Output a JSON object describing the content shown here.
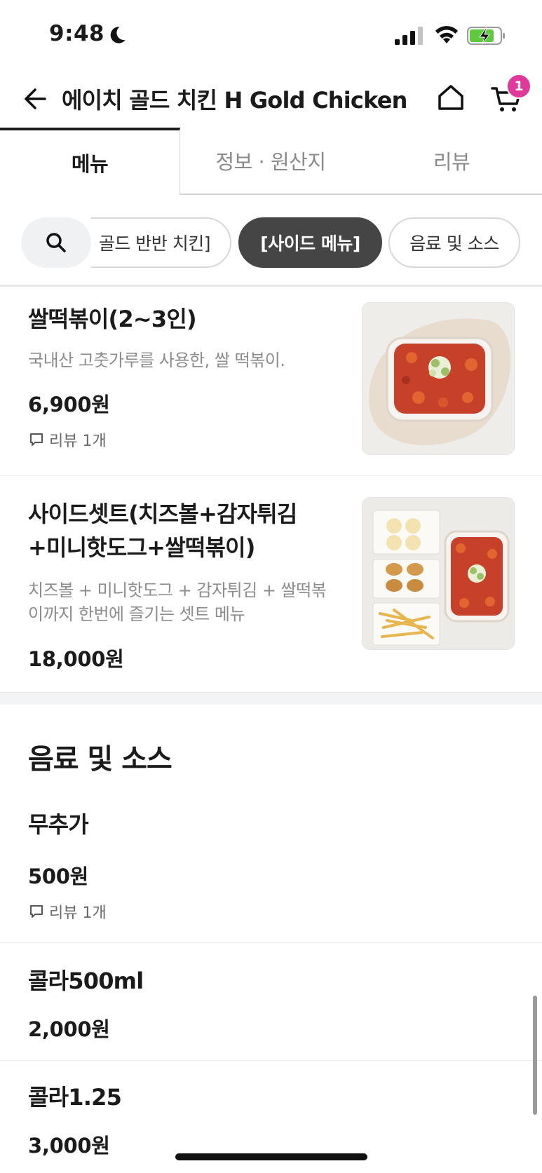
{
  "status_bar": {
    "time": "9:48"
  },
  "header": {
    "title": "에이치 골드 치킨 H Gold Chicken",
    "cart_count": "1"
  },
  "tabs": [
    {
      "label": "메뉴",
      "active": true
    },
    {
      "label": "정보 · 원산지",
      "active": false
    },
    {
      "label": "리뷰",
      "active": false
    }
  ],
  "chips": [
    {
      "label": "골드 반반 치킨]",
      "active": false
    },
    {
      "label": "[사이드 메뉴]",
      "active": true
    },
    {
      "label": "음료 및 소스",
      "active": false
    }
  ],
  "side_items": [
    {
      "name": "쌀떡볶이(2~3인)",
      "desc": "국내산 고춧가루를 사용한, 쌀 떡볶이.",
      "price": "6,900원",
      "review": "리뷰 1개"
    },
    {
      "name_line1": "사이드셋트(치즈볼+감자튀김",
      "name_line2": "+미니핫도그+쌀떡볶이)",
      "desc_line1": "치즈볼 + 미니핫도그 + 감자튀김 + 쌀떡볶",
      "desc_line2": "이까지 한번에 즐기는 셋트 메뉴",
      "price": "18,000원"
    }
  ],
  "drinks_section": {
    "title": "음료 및 소스",
    "items": [
      {
        "name": "무추가",
        "price": "500원",
        "review": "리뷰 1개"
      },
      {
        "name": "콜라500ml",
        "price": "2,000원"
      },
      {
        "name": "콜라1.25",
        "price": "3,000원"
      }
    ]
  },
  "colors": {
    "badge": "#e0389b",
    "active_chip": "#454545"
  }
}
